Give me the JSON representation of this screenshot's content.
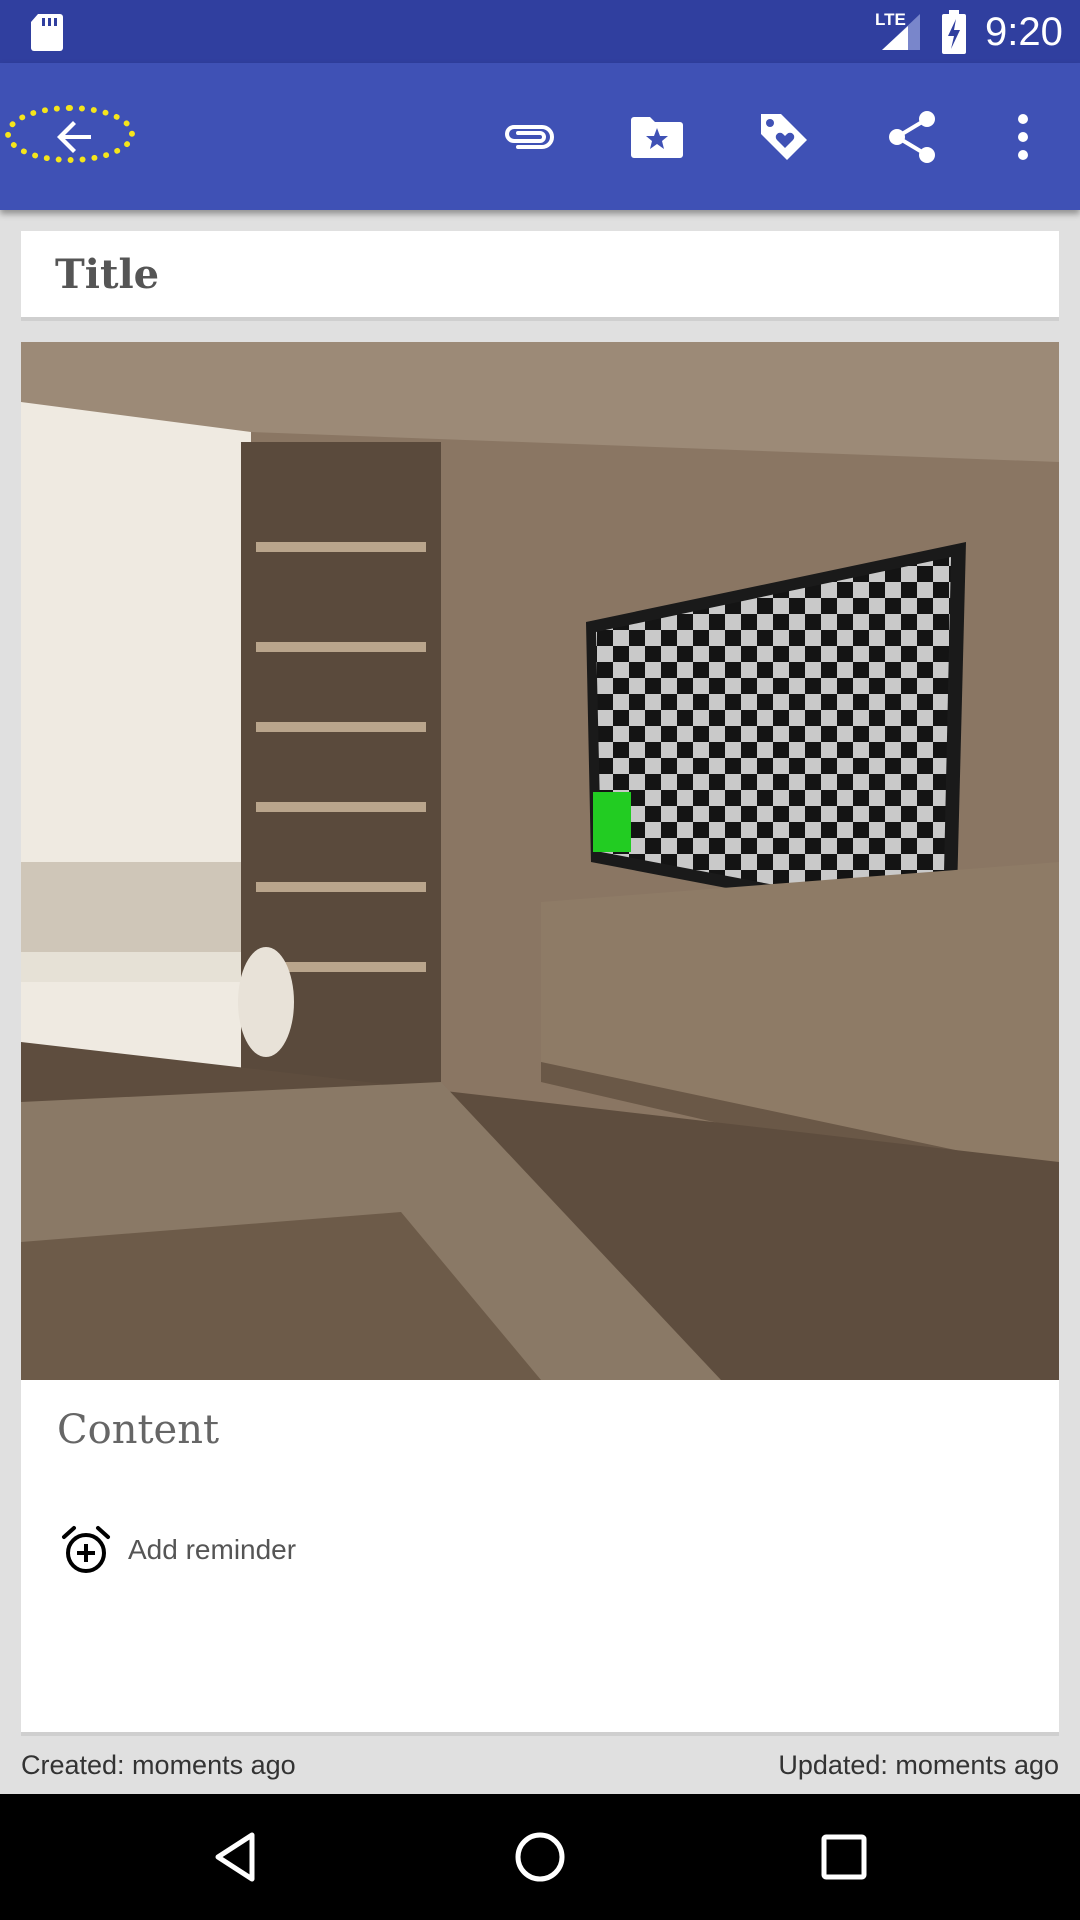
{
  "status_bar": {
    "network_label": "LTE",
    "time": "9:20"
  },
  "toolbar": {
    "icons": [
      "back-arrow-icon",
      "attachment-icon",
      "folder-star-icon",
      "tag-heart-icon",
      "share-icon",
      "more-vert-icon"
    ],
    "accent_color": "#3f51b5",
    "status_color": "#303f9f",
    "highlight_color": "#f5e51b"
  },
  "note": {
    "title_placeholder": "Title",
    "content_placeholder": "Content",
    "reminder_label": "Add reminder"
  },
  "footer": {
    "created": "Created: moments ago",
    "updated": "Updated: moments ago"
  },
  "nav_bar": {
    "icons": [
      "back-triangle-icon",
      "home-circle-icon",
      "recents-square-icon"
    ]
  }
}
